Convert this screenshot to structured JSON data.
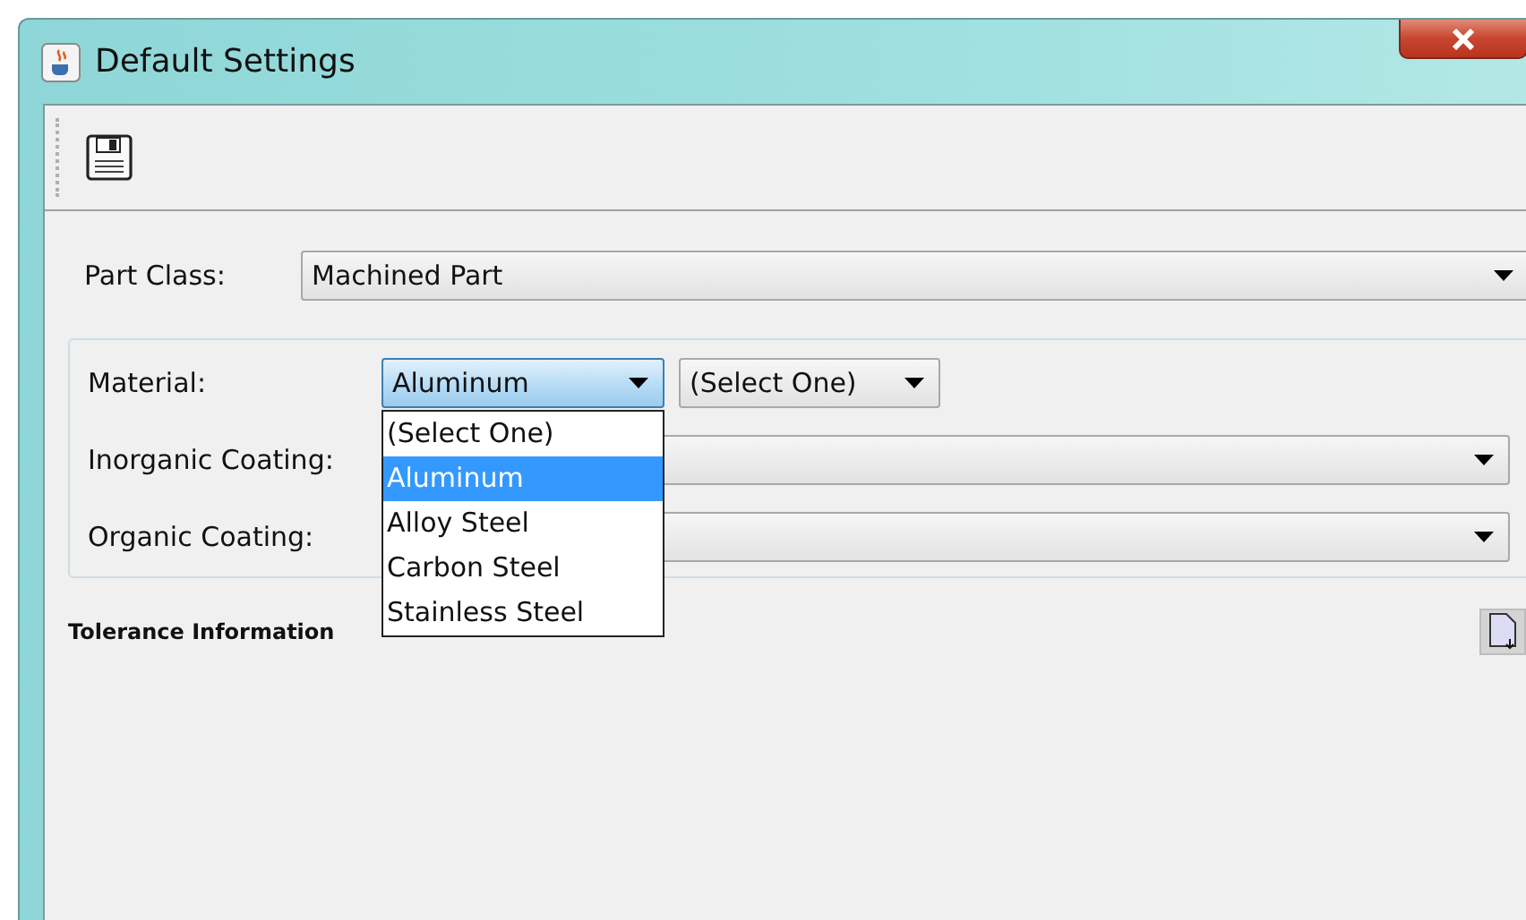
{
  "window": {
    "title": "Default Settings"
  },
  "form": {
    "part_class": {
      "label": "Part Class:",
      "value": "Machined Part"
    },
    "material": {
      "label": "Material:",
      "value": "Aluminum",
      "expanded": true,
      "sub_value": "(Select One)",
      "options": [
        {
          "label": "(Select One)",
          "selected": false
        },
        {
          "label": "Aluminum",
          "selected": true
        },
        {
          "label": "Alloy Steel",
          "selected": false
        },
        {
          "label": "Carbon Steel",
          "selected": false
        },
        {
          "label": "Stainless Steel",
          "selected": false
        }
      ]
    },
    "inorganic_coating": {
      "label": "Inorganic Coating:"
    },
    "organic_coating": {
      "label": "Organic Coating:"
    }
  },
  "tolerance": {
    "title": "Tolerance Information"
  }
}
